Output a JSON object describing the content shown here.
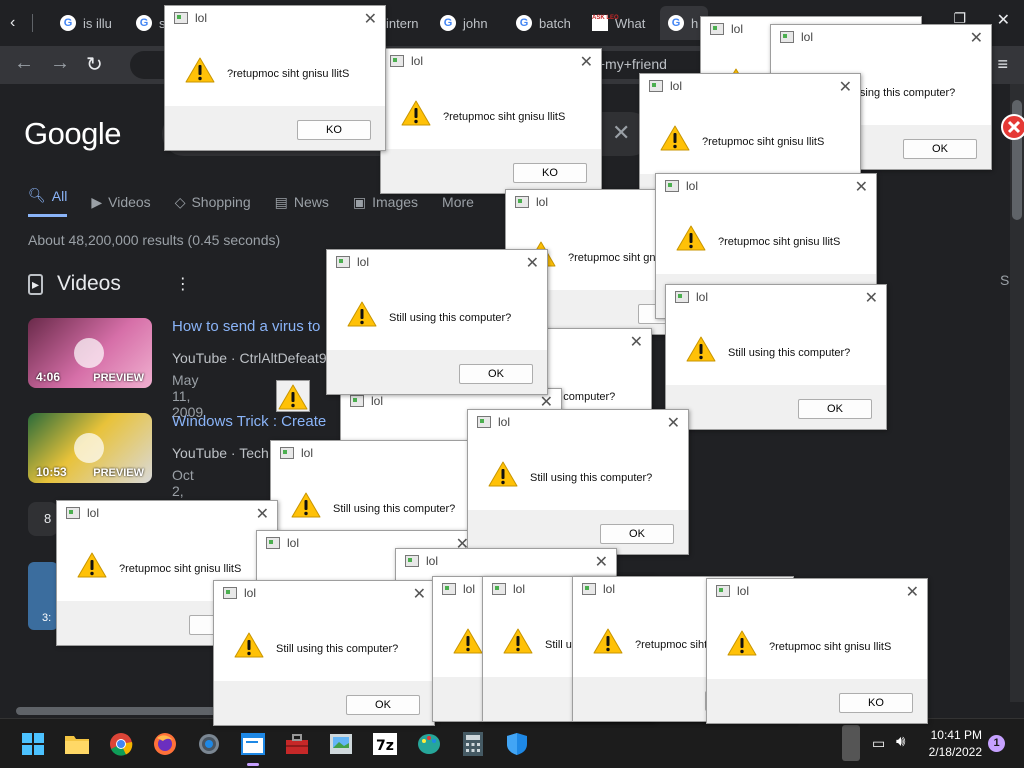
{
  "browser": {
    "tabs": [
      {
        "label": "is illu",
        "icon": "google-icon"
      },
      {
        "label": "s",
        "icon": "google-icon"
      },
      {
        "label": "intern",
        "icon": "google-icon"
      },
      {
        "label": "john",
        "icon": "google-icon"
      },
      {
        "label": "batch",
        "icon": "google-icon"
      },
      {
        "label": "What",
        "icon": "ask-leo-icon"
      },
      {
        "label": "h",
        "icon": "google-icon"
      }
    ],
    "omnibox_text": "s+to+my+friend"
  },
  "google": {
    "logo": "Google",
    "nav_tabs": [
      "All",
      "Videos",
      "Shopping",
      "News",
      "Images",
      "More"
    ],
    "results_count": "About 48,200,000 results (0.45 seconds)",
    "videos_heading": "Videos",
    "videos": [
      {
        "title": "How to send a virus to",
        "source": "YouTube · CtrlAltDefeat9",
        "date": "May 11, 2009",
        "duration": "4:06",
        "preview": "PREVIEW"
      },
      {
        "title": "Windows Trick : Create",
        "source": "YouTube · Tech",
        "date": "Oct 2, 2016",
        "duration": "10:53",
        "preview": "PREVIEW"
      }
    ],
    "more_count": "8",
    "small_thumb_label": "3:",
    "side_letter": "S"
  },
  "dialogs": [
    {
      "title": "lol",
      "message": "Still using this computer?",
      "button": "OK"
    },
    {
      "title": "lol",
      "message": "?retupmoc siht gnisu llitS",
      "button": "KO"
    },
    {
      "title": "lol",
      "message": "?retupmoc siht gnisu llitS",
      "button": "KO"
    },
    {
      "title": "lol",
      "message": "?retupmoc siht gnisu llitS",
      "button": "KO"
    },
    {
      "title": "lol",
      "message": "?retupmoc siht gnisu llitS",
      "button": "KO"
    },
    {
      "title": "lol",
      "message": "Still using this computer?",
      "button": "OK"
    },
    {
      "title": "lol",
      "message": "?retupmoc siht gnisu llitS",
      "button": "KO"
    },
    {
      "title": "lol",
      "message": "Still using this computer?",
      "button": "OK"
    },
    {
      "title": "lol",
      "message": "Still using this computer?",
      "button": "OK"
    },
    {
      "title": "lol",
      "message": "Still using this computer?",
      "button": "OK"
    },
    {
      "title": "lol",
      "message": "?retupmoc siht gnisu llitS",
      "button": "KO"
    },
    {
      "title": "lol",
      "message": "Still using this computer?",
      "button": "OK"
    },
    {
      "title": "lol",
      "message": "Still using this computer?",
      "button": "OK"
    },
    {
      "title": "lol",
      "message": "?retupmoc siht gnisu llitS",
      "button": "KO"
    },
    {
      "title": "lol",
      "message": "?retupmoc siht gnisu llitS",
      "button": "KO"
    },
    {
      "title": "lol",
      "message": "?retupmoc siht gnisu llitS",
      "button": "KO"
    },
    {
      "title": "lol",
      "message": "Still using this computer?",
      "button": "OK"
    },
    {
      "title": "lol",
      "message": "?retupmoc siht gnisu llitS",
      "button": "KO"
    },
    {
      "title": "lol",
      "message": "Still using this computer?",
      "button": "OK"
    },
    {
      "title": "lol",
      "message": "?retupmoc siht gnisu llitS",
      "button": "KO"
    },
    {
      "title": "lol",
      "message": "?retupmoc siht gnisu llitS",
      "button": "KO"
    },
    {
      "title": "lol",
      "message": "?retupmoc siht gnisu llitS",
      "button": "KO"
    }
  ],
  "taskbar": {
    "apps": [
      "start-icon",
      "file-explorer-icon",
      "chrome-icon",
      "firefox-icon",
      "settings-icon",
      "notepad-icon",
      "toolbox-icon",
      "image-viewer-icon",
      "7zip-icon",
      "paint-icon",
      "calculator-icon",
      "defender-icon"
    ],
    "time": "10:41 PM",
    "date": "2/18/2022",
    "notification_count": "1",
    "accent": "#c6a1ff"
  }
}
